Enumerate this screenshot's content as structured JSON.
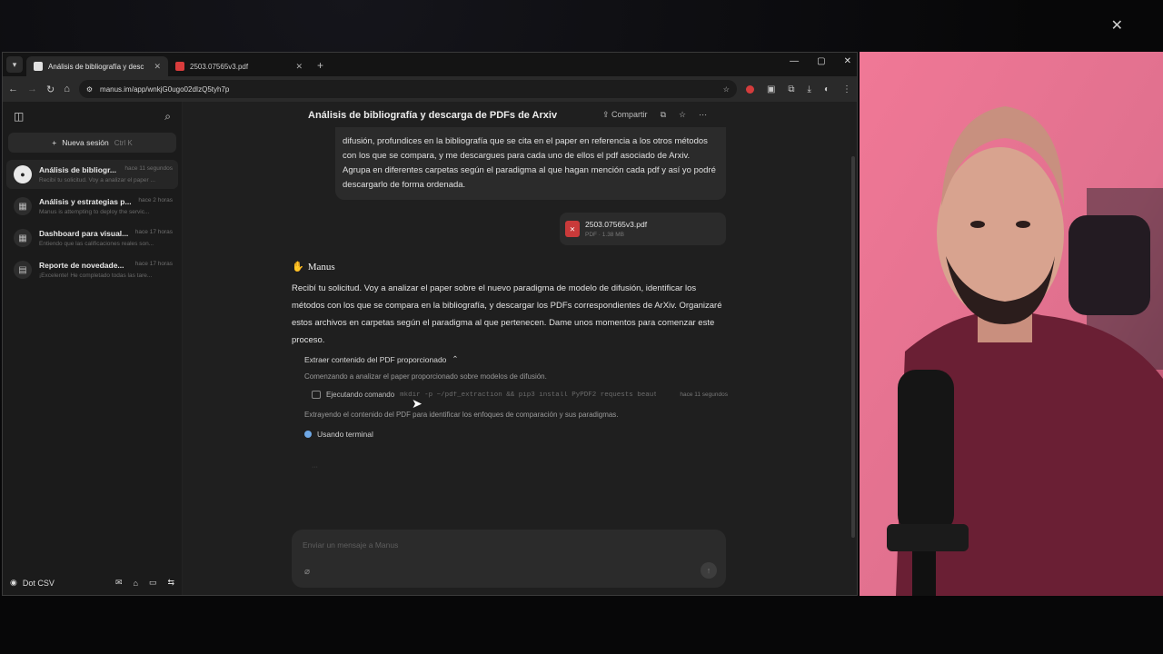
{
  "window": {
    "close_glyph": "✕"
  },
  "tabs": [
    {
      "label": "Análisis de bibliografía y desc",
      "favicon_color": "#e2e2e2"
    },
    {
      "label": "2503.07565v3.pdf",
      "favicon_color": "#d93c3c"
    }
  ],
  "tab_new": "+",
  "address": {
    "url": "manus.im/app/wnkjG0ugo02dIzQ5tyh7p"
  },
  "sidebar": {
    "new_session": {
      "label": "Nueva sesión",
      "shortcut": "Ctrl  K"
    },
    "sessions": [
      {
        "title": "Análisis de bibliogr...",
        "time": "hace 11 segundos",
        "preview": "Recibí tu solicitud. Voy a analizar el paper ..."
      },
      {
        "title": "Análisis y estrategias p...",
        "time": "hace 2 horas",
        "preview": "Manus is attempting to deploy the servic..."
      },
      {
        "title": "Dashboard para visual...",
        "time": "hace 17 horas",
        "preview": "Entiendo que las calificaciones reales son..."
      },
      {
        "title": "Reporte de novedade...",
        "time": "hace 17 horas",
        "preview": "¡Excelente! He completado todas las tare..."
      }
    ],
    "footer": {
      "user": "Dot CSV"
    }
  },
  "chat": {
    "title": "Análisis de bibliografía y descarga de PDFs de Arxiv",
    "share_label": "Compartir",
    "user_message": "difusión, profundices en la bibliografía que se cita en el paper en referencia a los otros métodos con los que se compara, y me descargues para cada uno de ellos el pdf asociado de Arxiv. Agrupa en diferentes carpetas según el paradigma al que hagan mención cada pdf y así yo podré descargarlo de forma ordenada.",
    "attachment": {
      "name": "2503.07565v3.pdf",
      "meta": "PDF · 1.38 MB"
    },
    "assistant_name": "Manus",
    "assistant_message": "Recibí tu solicitud. Voy a analizar el paper sobre el nuevo paradigma de modelo de difusión, identificar los métodos con los que se compara en la bibliografía, y descargar los PDFs correspondientes de ArXiv. Organizaré estos archivos en carpetas según el paradigma al que pertenecen. Dame unos momentos para comenzar este proceso.",
    "step": {
      "title": "Extraer contenido del PDF proporcionado",
      "description": "Comenzando a analizar el paper proporcionado sobre modelos de difusión.",
      "command_label": "Ejecutando comando",
      "command": "mkdir -p ~/pdf_extraction && pip3 install PyPDF2 requests beaut",
      "command_time": "hace 11 segundos",
      "note": "Extrayendo el contenido del PDF para identificar los enfoques de comparación y sus paradigmas.",
      "status": "Usando terminal"
    },
    "composer_placeholder": "Enviar un mensaje a Manus"
  }
}
